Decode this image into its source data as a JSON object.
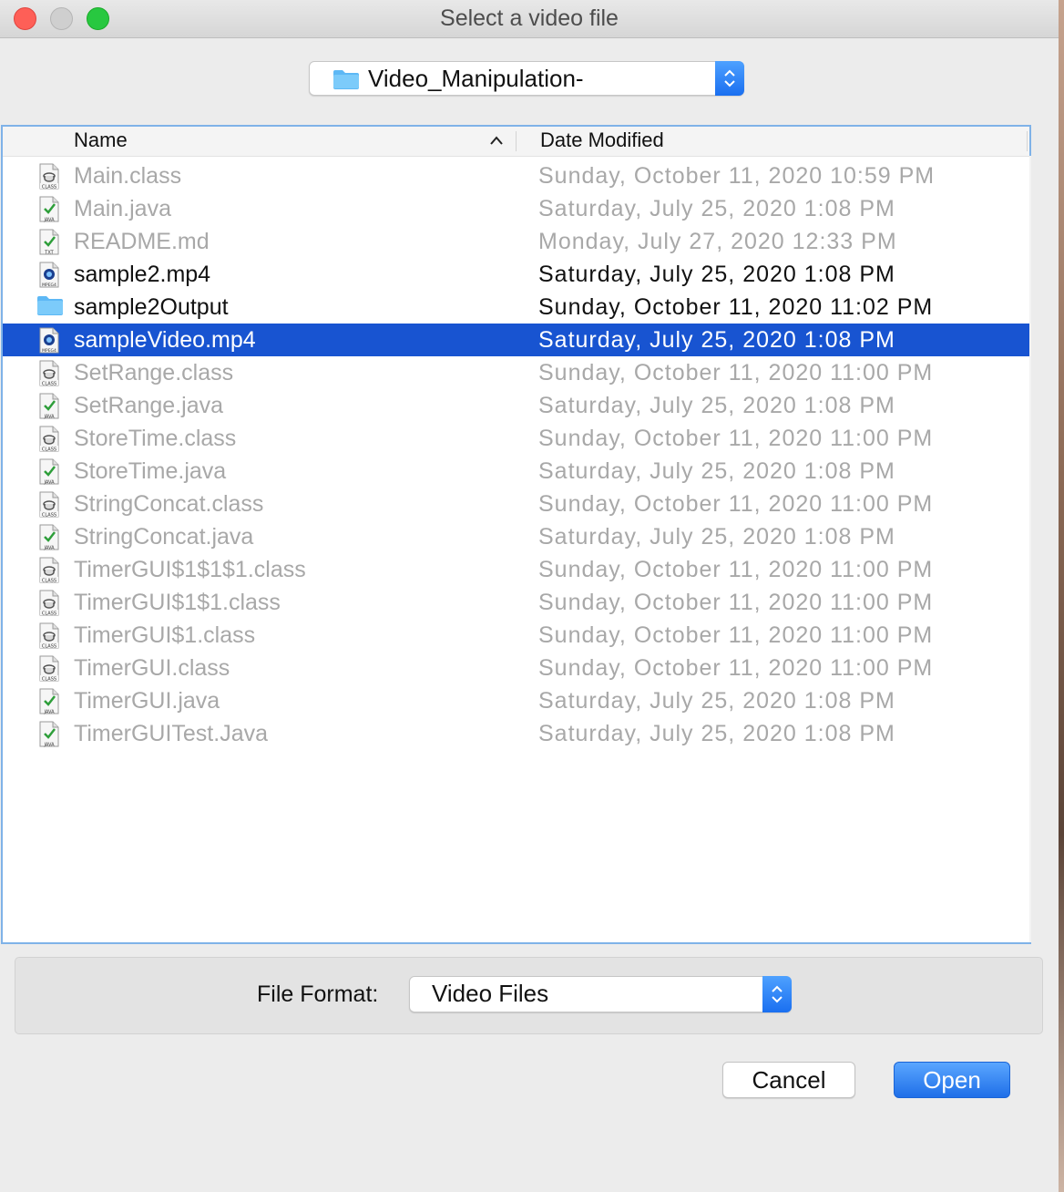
{
  "window": {
    "title": "Select a video file"
  },
  "location": {
    "folder": "Video_Manipulation-"
  },
  "columns": {
    "name": "Name",
    "date": "Date Modified"
  },
  "files": [
    {
      "name": "Main.class",
      "date": "Sunday, October 11, 2020 10:59 PM",
      "icon": "class-file-icon",
      "state": "disabled"
    },
    {
      "name": "Main.java",
      "date": "Saturday, July 25, 2020 1:08 PM",
      "icon": "java-file-icon",
      "state": "disabled"
    },
    {
      "name": "README.md",
      "date": "Monday, July 27, 2020 12:33 PM",
      "icon": "txt-file-icon",
      "state": "disabled"
    },
    {
      "name": "sample2.mp4",
      "date": "Saturday, July 25, 2020 1:08 PM",
      "icon": "mpeg-file-icon",
      "state": "enabled"
    },
    {
      "name": "sample2Output",
      "date": "Sunday, October 11, 2020 11:02 PM",
      "icon": "folder-icon",
      "state": "enabled"
    },
    {
      "name": "sampleVideo.mp4",
      "date": "Saturday, July 25, 2020 1:08 PM",
      "icon": "mpeg-file-icon",
      "state": "selected"
    },
    {
      "name": "SetRange.class",
      "date": "Sunday, October 11, 2020 11:00 PM",
      "icon": "class-file-icon",
      "state": "disabled"
    },
    {
      "name": "SetRange.java",
      "date": "Saturday, July 25, 2020 1:08 PM",
      "icon": "java-file-icon",
      "state": "disabled"
    },
    {
      "name": "StoreTime.class",
      "date": "Sunday, October 11, 2020 11:00 PM",
      "icon": "class-file-icon",
      "state": "disabled"
    },
    {
      "name": "StoreTime.java",
      "date": "Saturday, July 25, 2020 1:08 PM",
      "icon": "java-file-icon",
      "state": "disabled"
    },
    {
      "name": "StringConcat.class",
      "date": "Sunday, October 11, 2020 11:00 PM",
      "icon": "class-file-icon",
      "state": "disabled"
    },
    {
      "name": "StringConcat.java",
      "date": "Saturday, July 25, 2020 1:08 PM",
      "icon": "java-file-icon",
      "state": "disabled"
    },
    {
      "name": "TimerGUI$1$1$1.class",
      "date": "Sunday, October 11, 2020 11:00 PM",
      "icon": "class-file-icon",
      "state": "disabled"
    },
    {
      "name": "TimerGUI$1$1.class",
      "date": "Sunday, October 11, 2020 11:00 PM",
      "icon": "class-file-icon",
      "state": "disabled"
    },
    {
      "name": "TimerGUI$1.class",
      "date": "Sunday, October 11, 2020 11:00 PM",
      "icon": "class-file-icon",
      "state": "disabled"
    },
    {
      "name": "TimerGUI.class",
      "date": "Sunday, October 11, 2020 11:00 PM",
      "icon": "class-file-icon",
      "state": "disabled"
    },
    {
      "name": "TimerGUI.java",
      "date": "Saturday, July 25, 2020 1:08 PM",
      "icon": "java-file-icon",
      "state": "disabled"
    },
    {
      "name": "TimerGUITest.Java",
      "date": "Saturday, July 25, 2020 1:08 PM",
      "icon": "java-file-icon",
      "state": "disabled"
    }
  ],
  "format": {
    "label": "File Format:",
    "value": "Video Files"
  },
  "buttons": {
    "cancel": "Cancel",
    "open": "Open"
  },
  "colors": {
    "selection": "#1854d1",
    "accent": "#1f6fe8",
    "disabled_text": "#a8a8a8"
  }
}
